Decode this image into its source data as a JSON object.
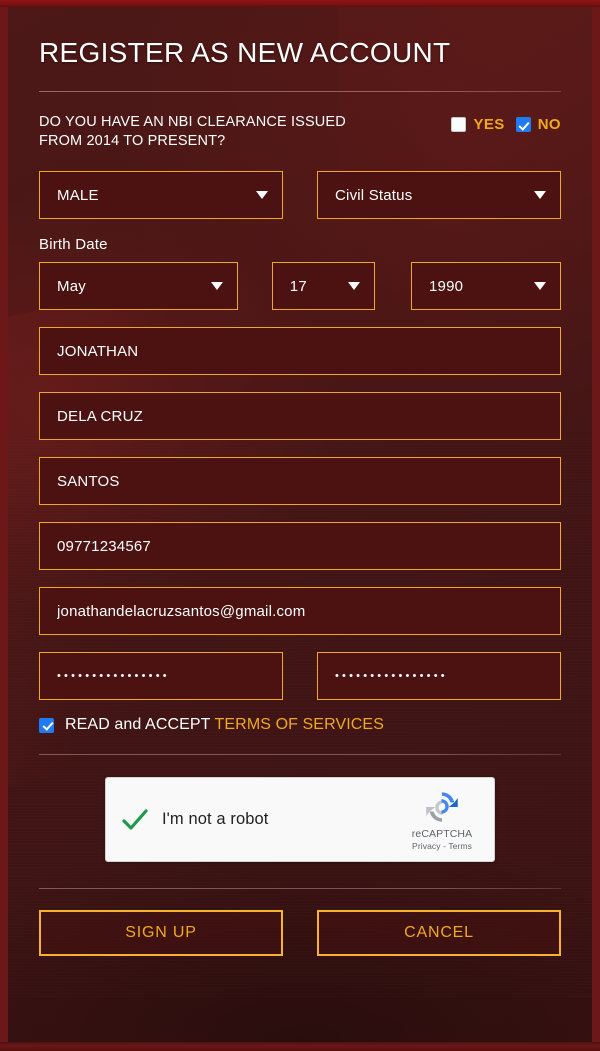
{
  "header": {
    "title": "REGISTER AS NEW ACCOUNT"
  },
  "nbi_question": {
    "text": "DO YOU HAVE AN NBI CLEARANCE ISSUED FROM 2014 TO PRESENT?",
    "options": [
      {
        "label": "YES",
        "checked": false
      },
      {
        "label": "NO",
        "checked": true
      }
    ]
  },
  "form": {
    "gender": {
      "value": "MALE",
      "caret": "chevron-down-icon"
    },
    "civil_status": {
      "value": "Civil Status",
      "caret": "chevron-down-icon"
    },
    "birth_date_label": "Birth Date",
    "birth_month": {
      "value": "May"
    },
    "birth_day": {
      "value": "17"
    },
    "birth_year": {
      "value": "1990"
    },
    "first_name": {
      "value": "JONATHAN"
    },
    "last_name": {
      "value": "DELA CRUZ"
    },
    "middle_name": {
      "value": "SANTOS"
    },
    "mobile": {
      "value": "09771234567"
    },
    "email": {
      "value": "jonathandelacruzsantos@gmail.com"
    },
    "password": {
      "value": "••••••••••••••••"
    },
    "confirm_password": {
      "value": "••••••••••••••••"
    }
  },
  "terms": {
    "prefix": "READ and ACCEPT",
    "link": "TERMS OF SERVICES",
    "checked": true
  },
  "recaptcha": {
    "label": "I'm not a robot",
    "brand": "reCAPTCHA",
    "legal": "Privacy - Terms",
    "verified": true
  },
  "actions": {
    "signup": "SIGN UP",
    "cancel": "CANCEL"
  },
  "colors": {
    "accent_gold": "#f0a81e",
    "border_gold": "#f7b42a",
    "page_bg": "#4a1616",
    "field_bg": "#4b1211",
    "frame_red": "#8e1414",
    "checkbox_blue": "#1f7bf2",
    "check_green": "#1e9949",
    "text_white": "#ffffff"
  }
}
